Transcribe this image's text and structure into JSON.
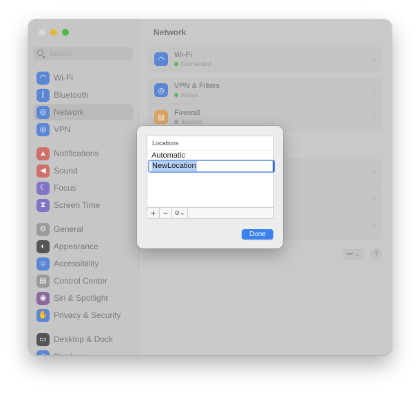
{
  "window": {
    "title": "Network",
    "traffic_lights": [
      "close",
      "minimize",
      "zoom"
    ]
  },
  "sidebar": {
    "search_placeholder": "Search",
    "items": [
      {
        "label": "Wi-Fi",
        "icon": "wifi-icon",
        "color": "#5b86d4",
        "glyph": "◠",
        "selected": false
      },
      {
        "label": "Bluetooth",
        "icon": "bluetooth-icon",
        "color": "#5b86d4",
        "glyph": "ᛒ",
        "selected": false
      },
      {
        "label": "Network",
        "icon": "globe-icon",
        "color": "#5b86d4",
        "glyph": "◎",
        "selected": true
      },
      {
        "label": "VPN",
        "icon": "vpn-globe-icon",
        "color": "#5b86d4",
        "glyph": "◎",
        "selected": false
      },
      {
        "label": "Notifications",
        "icon": "bell-icon",
        "color": "#cf6f6a",
        "glyph": "▲",
        "selected": false
      },
      {
        "label": "Sound",
        "icon": "speaker-icon",
        "color": "#cf6f6a",
        "glyph": "◀",
        "selected": false
      },
      {
        "label": "Focus",
        "icon": "moon-icon",
        "color": "#7f74c6",
        "glyph": "☾",
        "selected": false
      },
      {
        "label": "Screen Time",
        "icon": "hourglass-icon",
        "color": "#7f74c6",
        "glyph": "⧗",
        "selected": false
      },
      {
        "label": "General",
        "icon": "gear-icon",
        "color": "#9a9a9a",
        "glyph": "⚙",
        "selected": false
      },
      {
        "label": "Appearance",
        "icon": "appearance-icon",
        "color": "#555555",
        "glyph": "◐",
        "selected": false
      },
      {
        "label": "Accessibility",
        "icon": "accessibility-icon",
        "color": "#5b86d4",
        "glyph": "☺",
        "selected": false
      },
      {
        "label": "Control Center",
        "icon": "control-center-icon",
        "color": "#9a9a9a",
        "glyph": "▤",
        "selected": false
      },
      {
        "label": "Siri & Spotlight",
        "icon": "siri-icon",
        "color": "#8a6a9e",
        "glyph": "◉",
        "selected": false
      },
      {
        "label": "Privacy & Security",
        "icon": "hand-icon",
        "color": "#5b86d4",
        "glyph": "✋",
        "selected": false
      },
      {
        "label": "Desktop & Dock",
        "icon": "dock-icon",
        "color": "#555555",
        "glyph": "▭",
        "selected": false
      },
      {
        "label": "Displays",
        "icon": "display-icon",
        "color": "#5b86d4",
        "glyph": "☀",
        "selected": false
      }
    ]
  },
  "main": {
    "title": "Network",
    "services": [
      {
        "name": "Wi-Fi",
        "status": "Connected",
        "status_color": "#5cb85c",
        "icon": "wifi-icon",
        "icon_color": "#5b86d4"
      },
      {
        "name": "VPN & Filters",
        "status": "Active",
        "status_color": "#5cb85c",
        "icon": "vpn-globe-icon",
        "icon_color": "#5b86d4"
      },
      {
        "name": "Firewall",
        "status": "Inactive",
        "status_color": "#a0a0a0",
        "icon": "firewall-icon",
        "icon_color": "#d9a463"
      }
    ],
    "more_button": "••• ⌄",
    "help_button": "?"
  },
  "dialog": {
    "list_header": "Locations",
    "locations": [
      "Automatic"
    ],
    "editing_value": "NewLocation",
    "add_button": "+",
    "remove_button": "−",
    "action_button": "⊝⌄",
    "done_button": "Done"
  }
}
